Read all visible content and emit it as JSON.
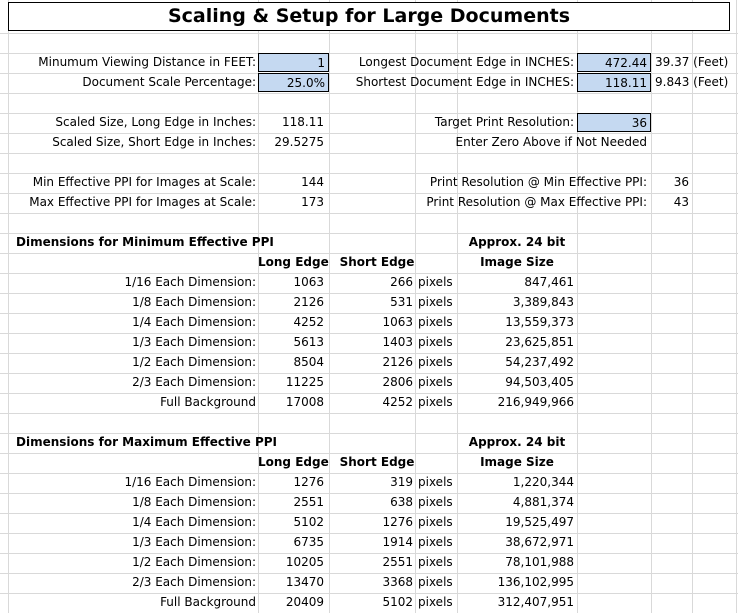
{
  "title": "Scaling & Setup for Large Documents",
  "setup": {
    "min_view_label": "Minumum Viewing Distance in FEET:",
    "min_view_value": "1",
    "scale_label": "Document Scale Percentage:",
    "scale_value": "25.0%",
    "long_edge_label": "Longest Document Edge in INCHES:",
    "long_edge_value": "472.44",
    "long_edge_feet": "39.37 (Feet)",
    "short_edge_label": "Shortest Document Edge in INCHES:",
    "short_edge_value": "118.11",
    "short_edge_feet": "9.843 (Feet)"
  },
  "scaled": {
    "long_label": "Scaled Size, Long Edge in Inches:",
    "long_value": "118.11",
    "short_label": "Scaled Size, Short Edge in Inches:",
    "short_value": "29.5275",
    "target_label": "Target Print Resolution:",
    "target_value": "36",
    "target_note": "Enter Zero Above if Not Needed"
  },
  "ppi": {
    "min_label": "Min Effective PPI for Images at Scale:",
    "min_value": "144",
    "max_label": "Max Effective PPI for Images at Scale:",
    "max_value": "173",
    "print_min_label": "Print Resolution @ Min Effective PPI:",
    "print_min_value": "36",
    "print_max_label": "Print Resolution @ Max Effective PPI:",
    "print_max_value": "43"
  },
  "headers": {
    "long_edge": "Long Edge",
    "short_edge": "Short Edge",
    "approx_line1": "Approx. 24 bit",
    "approx_line2": "Image Size",
    "pixels": "pixels"
  },
  "min_section": {
    "title": "Dimensions for Minimum Effective PPI",
    "rows": [
      {
        "label": "1/16 Each Dimension:",
        "long": "1063",
        "short": "266",
        "unit": "pixels",
        "size": "847,461"
      },
      {
        "label": "1/8 Each Dimension:",
        "long": "2126",
        "short": "531",
        "unit": "pixels",
        "size": "3,389,843"
      },
      {
        "label": "1/4 Each Dimension:",
        "long": "4252",
        "short": "1063",
        "unit": "pixels",
        "size": "13,559,373"
      },
      {
        "label": "1/3 Each Dimension:",
        "long": "5613",
        "short": "1403",
        "unit": "pixels",
        "size": "23,625,851"
      },
      {
        "label": "1/2 Each Dimension:",
        "long": "8504",
        "short": "2126",
        "unit": "pixels",
        "size": "54,237,492"
      },
      {
        "label": "2/3 Each Dimension:",
        "long": "11225",
        "short": "2806",
        "unit": "pixels",
        "size": "94,503,405"
      },
      {
        "label": "Full Background",
        "long": "17008",
        "short": "4252",
        "unit": "pixels",
        "size": "216,949,966"
      }
    ]
  },
  "max_section": {
    "title": "Dimensions for Maximum Effective PPI",
    "rows": [
      {
        "label": "1/16 Each Dimension:",
        "long": "1276",
        "short": "319",
        "unit": "pixels",
        "size": "1,220,344"
      },
      {
        "label": "1/8 Each Dimension:",
        "long": "2551",
        "short": "638",
        "unit": "pixels",
        "size": "4,881,374"
      },
      {
        "label": "1/4 Each Dimension:",
        "long": "5102",
        "short": "1276",
        "unit": "pixels",
        "size": "19,525,497"
      },
      {
        "label": "1/3 Each Dimension:",
        "long": "6735",
        "short": "1914",
        "unit": "pixels",
        "size": "38,672,971"
      },
      {
        "label": "1/2 Each Dimension:",
        "long": "10205",
        "short": "2551",
        "unit": "pixels",
        "size": "78,101,988"
      },
      {
        "label": "2/3 Each Dimension:",
        "long": "13470",
        "short": "3368",
        "unit": "pixels",
        "size": "136,102,995"
      },
      {
        "label": "Full Background",
        "long": "20409",
        "short": "5102",
        "unit": "pixels",
        "size": "312,407,951"
      }
    ]
  }
}
